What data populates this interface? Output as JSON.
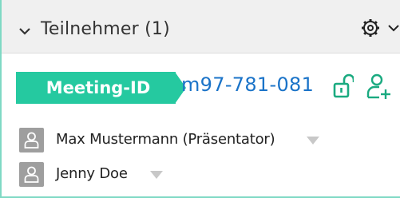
{
  "header": {
    "title": "Teilnehmer (1)",
    "collapse_icon": "chevron-down-icon",
    "settings_icon": "gear-icon"
  },
  "meeting": {
    "badge_label": "Meeting-ID",
    "id": "m97-781-081",
    "lock_icon": "unlocked-icon",
    "add_icon": "add-user-icon"
  },
  "participants": [
    {
      "name": "Max Mustermann (Präsentator)",
      "icon": "person-icon"
    },
    {
      "name": "Jenny Doe",
      "icon": "person-icon"
    }
  ],
  "colors": {
    "accent": "#25c9a0",
    "link": "#1a73c8",
    "border": "#7fd9c4",
    "header_bg": "#f0f0f0",
    "avatar_bg": "#9e9e9e"
  }
}
